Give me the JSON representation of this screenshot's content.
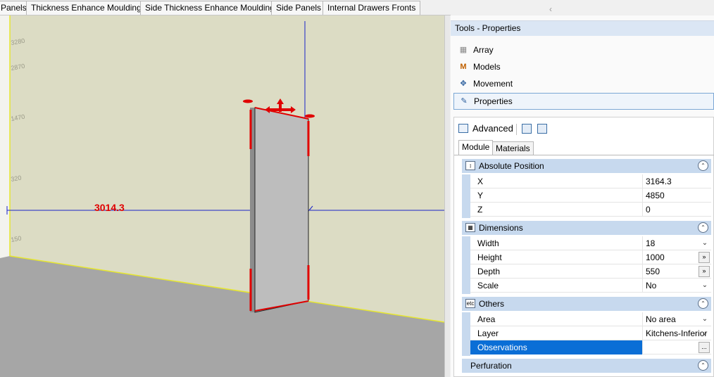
{
  "tabs": [
    "Panels",
    "Thickness Enhance Moulding",
    "Side Thickness Enhance Moulding",
    "Side Panels",
    "Internal Drawers Fronts"
  ],
  "collapse_icon": "chevron-left-icon",
  "viewport": {
    "dimension_label": "3014.3",
    "ruler_labels": [
      "3280",
      "2870",
      "1470",
      "320",
      "150"
    ],
    "colors": {
      "wall": "#dcdcc4",
      "floor": "#a8a8a8",
      "panel": "#b9b9b9",
      "dim_line": "#1a23c8",
      "dim_text": "#e00000",
      "handles": "#e00000",
      "edge": "#e8e840"
    }
  },
  "panel": {
    "title": "Tools - Properties",
    "tools": [
      {
        "label": "Array",
        "icon": "array-icon"
      },
      {
        "label": "Models",
        "icon": "models-icon"
      },
      {
        "label": "Movement",
        "icon": "move-icon"
      },
      {
        "label": "Properties",
        "icon": "properties-icon"
      }
    ],
    "advanced_label": "Advanced",
    "subtabs": [
      "Module",
      "Materials"
    ],
    "sections": {
      "absolute_position": {
        "title": "Absolute Position",
        "rows": [
          {
            "label": "X",
            "value": "3164.3"
          },
          {
            "label": "Y",
            "value": "4850"
          },
          {
            "label": "Z",
            "value": "0"
          }
        ]
      },
      "dimensions": {
        "title": "Dimensions",
        "rows": [
          {
            "label": "Width",
            "value": "18"
          },
          {
            "label": "Height",
            "value": "1000"
          },
          {
            "label": "Depth",
            "value": "550"
          },
          {
            "label": "Scale",
            "value": "No"
          }
        ]
      },
      "others": {
        "title": "Others",
        "icon_text": "etc",
        "rows": [
          {
            "label": "Area",
            "value": "No area"
          },
          {
            "label": "Layer",
            "value": "Kitchens-Inferior"
          },
          {
            "label": "Observations",
            "value": ""
          }
        ]
      },
      "perfuration": {
        "title": "Perfuration"
      }
    },
    "ellipsis": "»",
    "dots": "..."
  }
}
